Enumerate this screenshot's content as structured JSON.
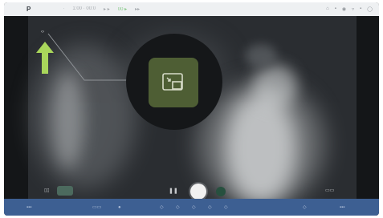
{
  "statusbar": {
    "logo": "P",
    "items": [
      "·",
      "1:00 · 00:0",
      "▸ ▸",
      "00 ▸",
      "▸▸"
    ],
    "right_icons": [
      "⌂",
      "▪",
      "◉",
      "▿",
      "▪",
      "◯"
    ]
  },
  "viewport": {
    "top_left_label": "‹›",
    "bottom_left_label": "▯▯",
    "pause_label": "❚❚",
    "bottom_right_label": "▭▭"
  },
  "taskbar": {
    "left_label": "▪▪▪",
    "mid_label": "▭▭",
    "right_label": "▪▪▪"
  },
  "colors": {
    "arrow": "#a9d65b",
    "zoom_button": "#4e5e34",
    "taskbar": "#3d5f92"
  }
}
